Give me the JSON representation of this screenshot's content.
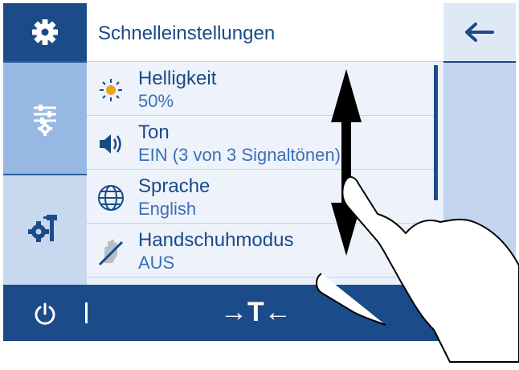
{
  "header": {
    "title": "Schnelleinstellungen"
  },
  "settings": [
    {
      "label": "Helligkeit",
      "value": "50%",
      "icon": "brightness-icon"
    },
    {
      "label": "Ton",
      "value": "EIN (3 von 3 Signaltönen)",
      "icon": "speaker-icon"
    },
    {
      "label": "Sprache",
      "value": "English",
      "icon": "globe-icon"
    },
    {
      "label": "Handschuhmodus",
      "value": "AUS",
      "icon": "glove-mode-icon"
    }
  ],
  "left_nav": [
    {
      "icon": "gear-icon"
    },
    {
      "icon": "settings-adjust-icon"
    },
    {
      "icon": "tools-settings-icon"
    }
  ],
  "bottom_bar": {
    "zero_label": "→T←",
    "icon": "power-icon"
  },
  "back_icon": "arrow-left-icon",
  "colors": {
    "primary": "#1c4b8a",
    "selected": "#98b8e4",
    "list_bg": "#eef3fb"
  }
}
